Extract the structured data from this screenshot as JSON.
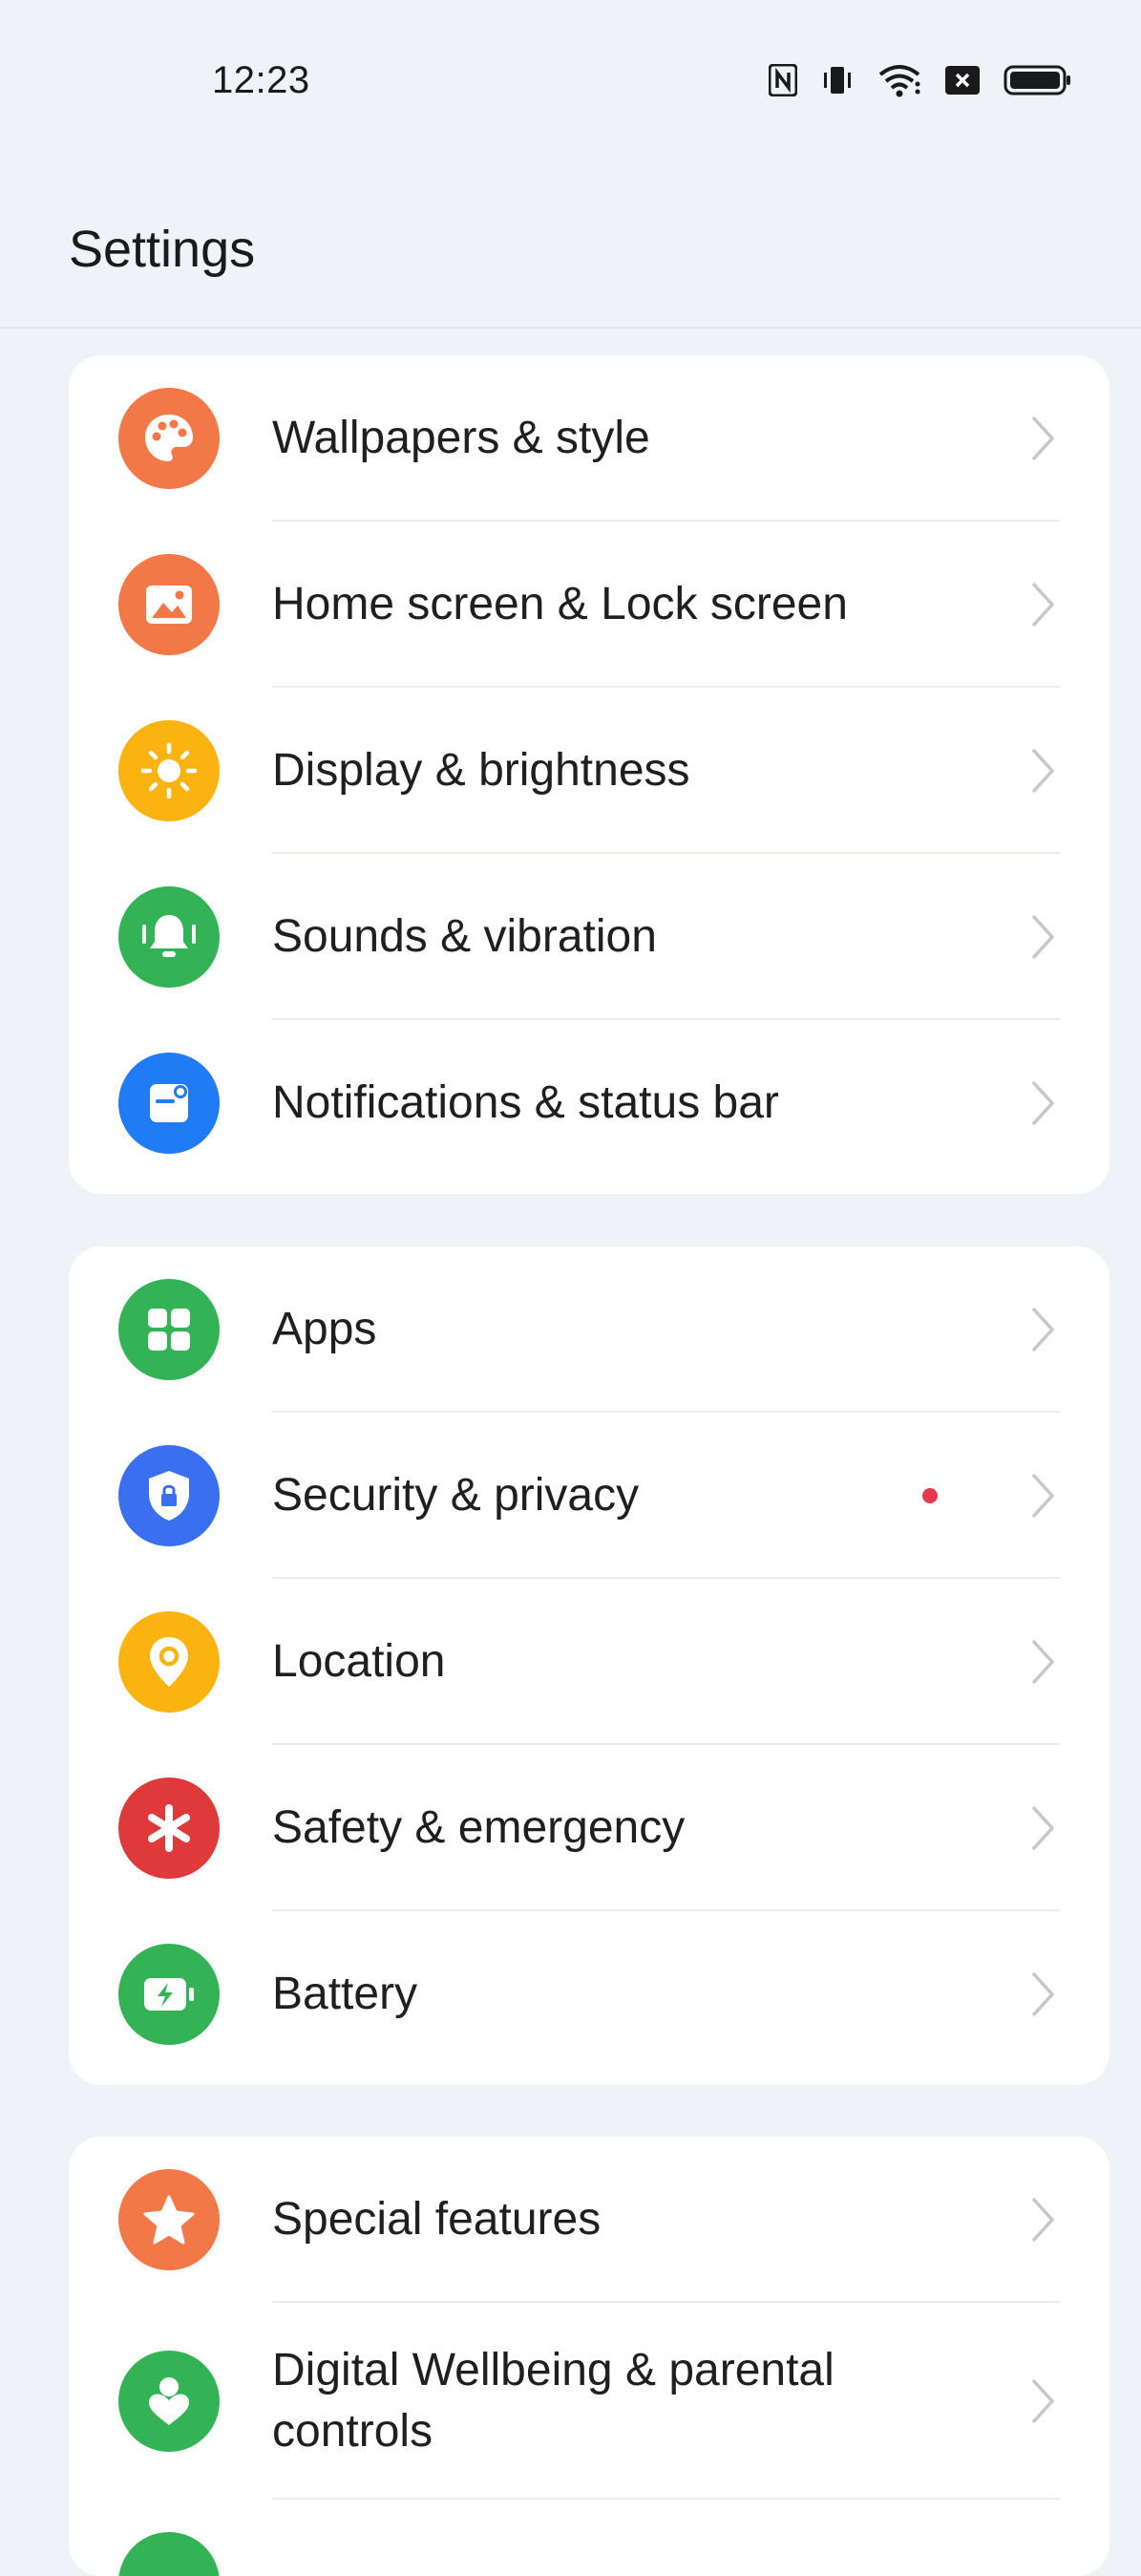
{
  "status_bar": {
    "time": "12:23",
    "icons": [
      "nfc-icon",
      "vibrate-icon",
      "wifi-icon",
      "sim-off-icon",
      "battery-icon"
    ]
  },
  "header": {
    "title": "Settings"
  },
  "colors": {
    "orange": "#f37848",
    "yellow": "#fbb312",
    "green": "#33b355",
    "blue": "#1f7cf5",
    "shield_blue": "#3a6ff0",
    "red": "#e0393b",
    "badge_red": "#e8384f",
    "chevron": "#c4c7cc"
  },
  "groups": [
    {
      "items": [
        {
          "label": "Wallpapers & style",
          "icon": "palette-icon"
        },
        {
          "label": "Home screen & Lock screen",
          "icon": "image-icon"
        },
        {
          "label": "Display & brightness",
          "icon": "sun-icon"
        },
        {
          "label": "Sounds & vibration",
          "icon": "bell-icon"
        },
        {
          "label": "Notifications & status bar",
          "icon": "notification-icon"
        }
      ]
    },
    {
      "items": [
        {
          "label": "Apps",
          "icon": "apps-grid-icon"
        },
        {
          "label": "Security & privacy",
          "icon": "shield-lock-icon"
        },
        {
          "label": "Location",
          "icon": "location-pin-icon"
        },
        {
          "label": "Safety & emergency",
          "icon": "asterisk-icon"
        },
        {
          "label": "Battery",
          "icon": "battery-charging-icon"
        }
      ]
    },
    {
      "items": [
        {
          "label": "Special features",
          "icon": "star-icon"
        },
        {
          "label": "Digital Wellbeing & parental controls",
          "icon": "wellbeing-heart-icon"
        },
        {
          "label": "",
          "icon": "partial-icon"
        }
      ]
    }
  ]
}
